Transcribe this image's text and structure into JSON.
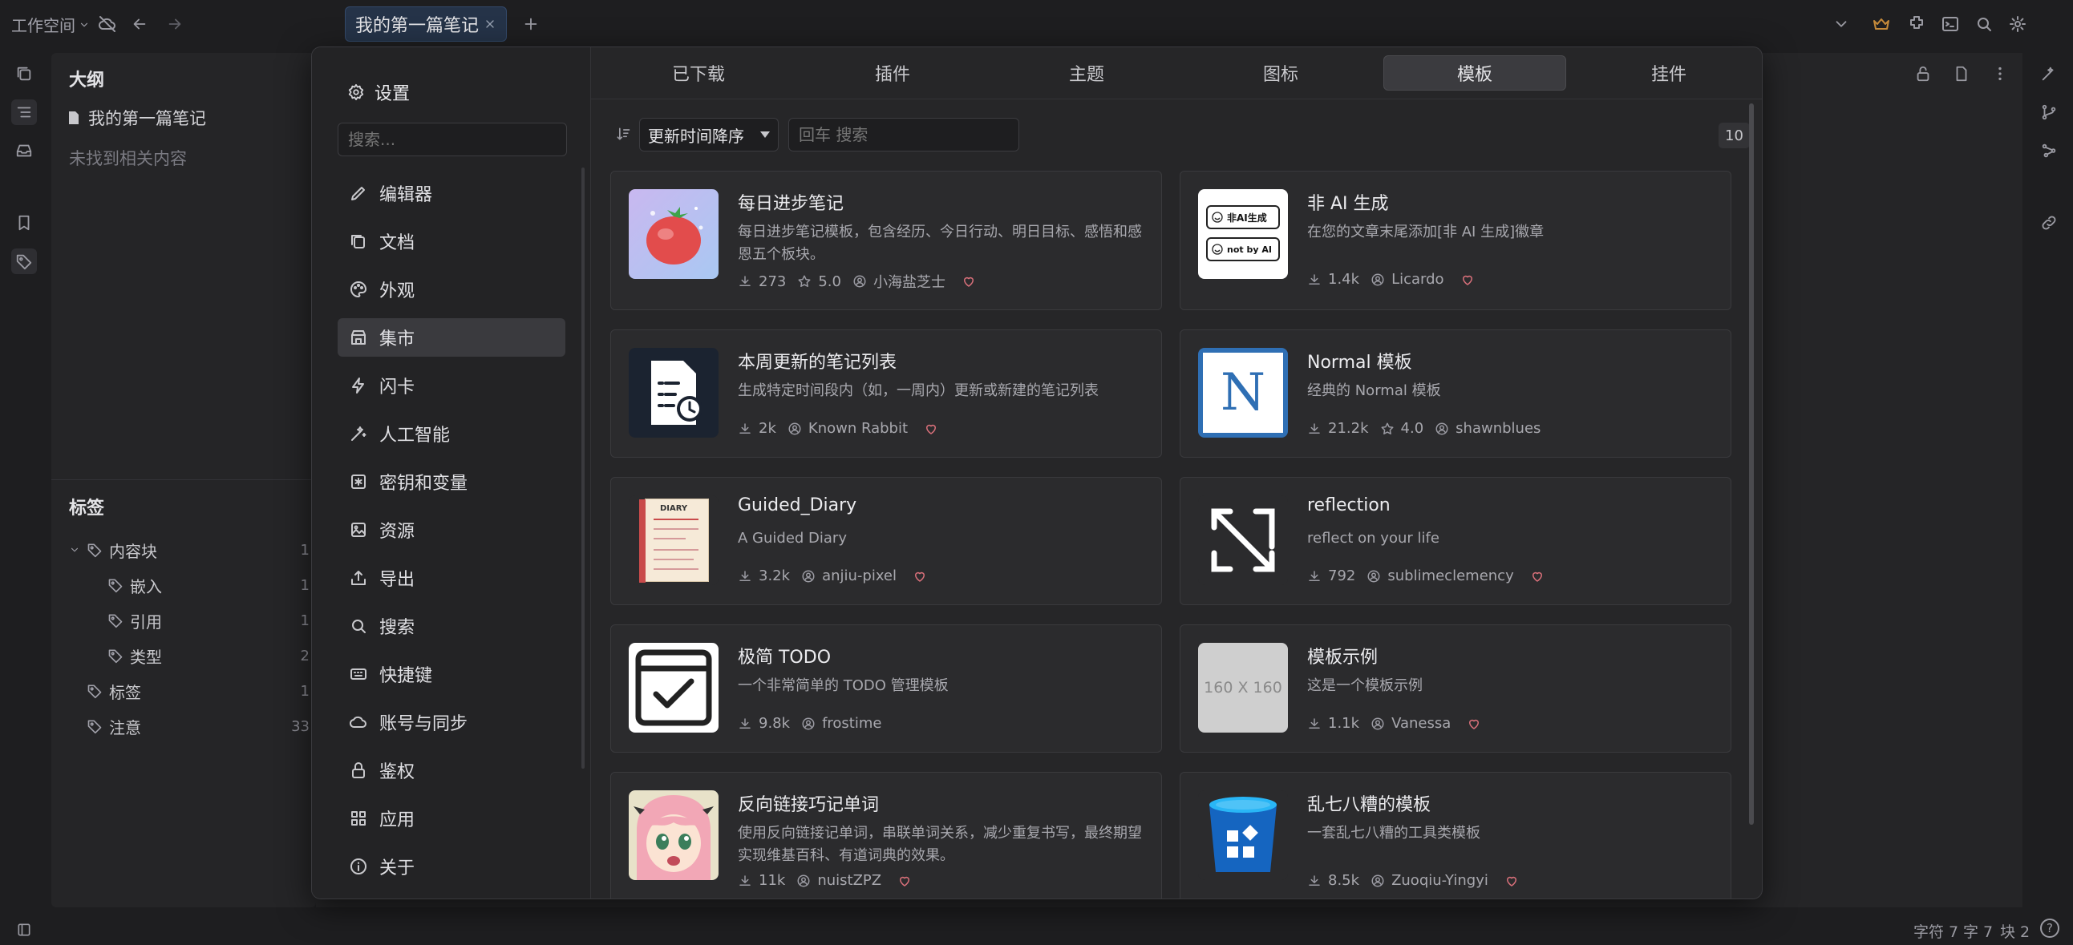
{
  "topbar": {
    "workspace": "工作空间",
    "tab_title": "我的第一篇笔记"
  },
  "outline": {
    "title": "大纲",
    "doc_name": "我的第一篇笔记",
    "empty": "未找到相关内容"
  },
  "tags": {
    "title": "标签",
    "items": [
      {
        "label": "内容块",
        "count": "1"
      },
      {
        "label": "嵌入",
        "count": "1"
      },
      {
        "label": "引用",
        "count": "1"
      },
      {
        "label": "类型",
        "count": "2"
      },
      {
        "label": "标签",
        "count": "1"
      },
      {
        "label": "注意",
        "count": "33"
      }
    ]
  },
  "settings": {
    "header": "设置",
    "search_placeholder": "搜索...",
    "nav": [
      {
        "label": "编辑器",
        "icon": "pencil-icon"
      },
      {
        "label": "文档",
        "icon": "document-icon"
      },
      {
        "label": "外观",
        "icon": "palette-icon"
      },
      {
        "label": "集市",
        "icon": "store-icon"
      },
      {
        "label": "闪卡",
        "icon": "flash-icon"
      },
      {
        "label": "人工智能",
        "icon": "wand-icon"
      },
      {
        "label": "密钥和变量",
        "icon": "key-icon"
      },
      {
        "label": "资源",
        "icon": "image-icon"
      },
      {
        "label": "导出",
        "icon": "export-icon"
      },
      {
        "label": "搜索",
        "icon": "search-icon"
      },
      {
        "label": "快捷键",
        "icon": "keyboard-icon"
      },
      {
        "label": "账号与同步",
        "icon": "cloud-icon"
      },
      {
        "label": "鉴权",
        "icon": "lock-icon"
      },
      {
        "label": "应用",
        "icon": "apps-icon"
      },
      {
        "label": "关于",
        "icon": "info-icon"
      }
    ]
  },
  "bazaar": {
    "tabs": [
      "已下载",
      "插件",
      "主题",
      "图标",
      "模板",
      "挂件"
    ],
    "active_tab": "模板",
    "sort_label": "更新时间降序",
    "search_placeholder": "回车 搜索",
    "count": "10",
    "cards": [
      {
        "title": "每日进步笔记",
        "desc": "每日进步笔记模板，包含经历、今日行动、明日目标、感悟和感恩五个板块。",
        "downloads": "273",
        "rating": "5.0",
        "author": "小海盐芝士",
        "thumb": "tomato"
      },
      {
        "title": "非 AI 生成",
        "desc": "在您的文章末尾添加[非 AI 生成]徽章",
        "downloads": "1.4k",
        "rating": "",
        "author": "Licardo",
        "thumb": "notai",
        "thumb_text1": "非AI生成",
        "thumb_text2": "not by AI"
      },
      {
        "title": "本周更新的笔记列表",
        "desc": "生成特定时间段内（如，一周内）更新或新建的笔记列表",
        "downloads": "2k",
        "rating": "",
        "author": "Known Rabbit",
        "thumb": "doclist"
      },
      {
        "title": "Normal 模板",
        "desc": "经典的 Normal 模板",
        "downloads": "21.2k",
        "rating": "4.0",
        "author": "shawnblues",
        "thumb": "normal",
        "thumb_text1": "N"
      },
      {
        "title": "Guided_Diary",
        "desc": "A Guided Diary",
        "downloads": "3.2k",
        "rating": "",
        "author": "anjiu-pixel",
        "thumb": "diary",
        "thumb_text1": "DIARY"
      },
      {
        "title": "reflection",
        "desc": "reflect on your life",
        "downloads": "792",
        "rating": "",
        "author": "sublimeclemency",
        "thumb": "reflection"
      },
      {
        "title": "极简 TODO",
        "desc": "一个非常简单的 TODO 管理模板",
        "downloads": "9.8k",
        "rating": "",
        "author": "frostime",
        "thumb": "todo"
      },
      {
        "title": "模板示例",
        "desc": "这是一个模板示例",
        "downloads": "1.1k",
        "rating": "",
        "author": "Vanessa",
        "thumb": "placeholder",
        "thumb_text1": "160 X 160"
      },
      {
        "title": "反向链接巧记单词",
        "desc": "使用反向链接记单词，串联单词关系，减少重复书写，最终期望实现维基百科、有道词典的效果。",
        "downloads": "11k",
        "rating": "",
        "author": "nuistZPZ",
        "thumb": "anime"
      },
      {
        "title": "乱七八糟的模板",
        "desc": "一套乱七八糟的工具类模板",
        "downloads": "8.5k",
        "rating": "",
        "author": "Zuoqiu-Yingyi",
        "thumb": "bucket"
      }
    ]
  },
  "statusbar": {
    "chars": "字符 7",
    "words": "字 7",
    "blocks": "块 2",
    "help": "?"
  },
  "colors": {
    "accent_tab": "#253348",
    "heart": "#d9707a"
  }
}
